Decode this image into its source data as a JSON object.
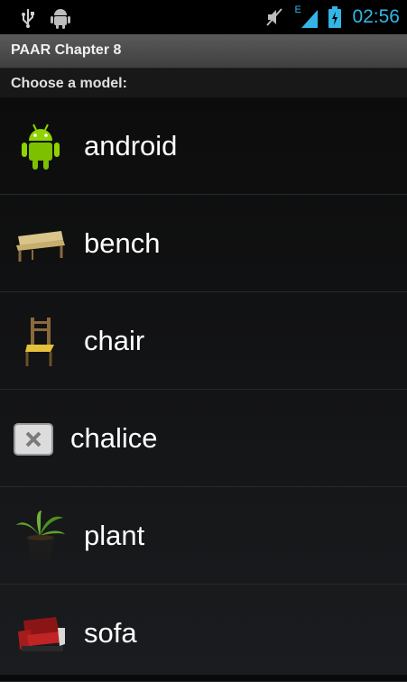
{
  "status_bar": {
    "time": "02:56",
    "network_type": "E",
    "icons": [
      "usb-icon",
      "android-debug-icon",
      "mute-icon",
      "signal-icon",
      "battery-charging-icon"
    ]
  },
  "app": {
    "title": "PAAR Chapter 8"
  },
  "list_header": "Choose a model:",
  "items": [
    {
      "label": "android",
      "icon": "android-icon"
    },
    {
      "label": "bench",
      "icon": "bench-icon"
    },
    {
      "label": "chair",
      "icon": "chair-icon"
    },
    {
      "label": "chalice",
      "icon": "broken-image-icon"
    },
    {
      "label": "plant",
      "icon": "plant-icon"
    },
    {
      "label": "sofa",
      "icon": "sofa-icon"
    }
  ],
  "colors": {
    "status_accent": "#33b5e5",
    "android_green": "#8fd400"
  }
}
